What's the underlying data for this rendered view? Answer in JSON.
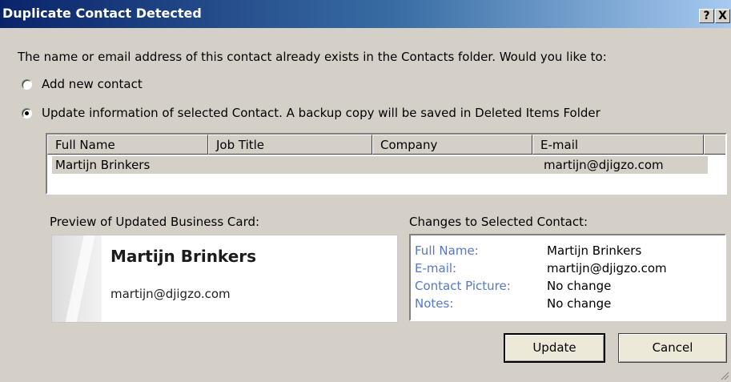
{
  "dialog": {
    "title": "Duplicate Contact Detected",
    "help_button": "?",
    "close_button": "X",
    "prompt": "The name or email address of this contact already exists in the Contacts folder. Would you like to:"
  },
  "options": {
    "add_new": "Add new contact",
    "update": "Update information of selected Contact. A backup copy will be saved in Deleted Items Folder",
    "selected": "update"
  },
  "table": {
    "columns": [
      "Full Name",
      "Job Title",
      "Company",
      "E-mail"
    ],
    "rows": [
      {
        "full_name": "Martijn Brinkers",
        "job_title": "",
        "company": "",
        "email": "martijn@djigzo.com"
      }
    ]
  },
  "preview": {
    "label": "Preview of Updated Business Card:",
    "name": "Martijn Brinkers",
    "email": "martijn@djigzo.com"
  },
  "changes": {
    "label": "Changes to Selected Contact:",
    "items": [
      {
        "field": "Full Name:",
        "value": "Martijn Brinkers"
      },
      {
        "field": "E-mail:",
        "value": "martijn@djigzo.com"
      },
      {
        "field": "Contact Picture:",
        "value": "No change"
      },
      {
        "field": "Notes:",
        "value": "No change"
      }
    ]
  },
  "buttons": {
    "update": "Update",
    "cancel": "Cancel"
  }
}
